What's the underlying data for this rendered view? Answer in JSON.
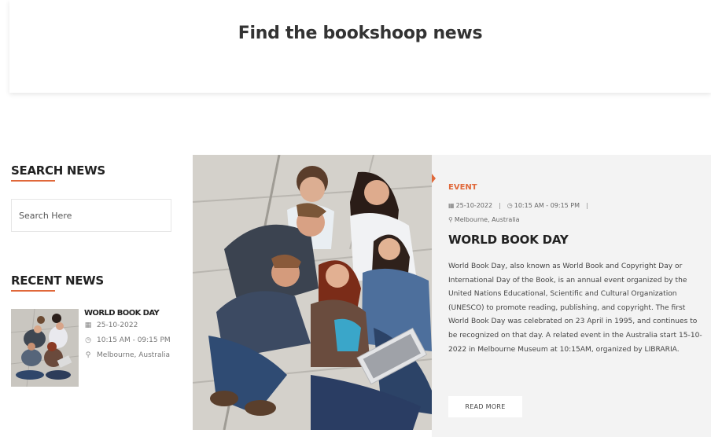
{
  "hero": {
    "title": "Find the bookshoop news"
  },
  "sidebar": {
    "search_title": "SEARCH NEWS",
    "search_placeholder": "Search Here",
    "recent_title": "RECENT NEWS",
    "recent_items": [
      {
        "title": "WORLD BOOK DAY",
        "date": "25-10-2022",
        "time": "10:15 AM - 09:15 PM",
        "location": "Melbourne, Australia"
      }
    ]
  },
  "article": {
    "category": "EVENT",
    "date": "25-10-2022",
    "time": "10:15 AM - 09:15 PM",
    "location": "Melbourne, Australia",
    "title": "WORLD BOOK DAY",
    "description": "World Book Day, also known as World Book and Copyright Day or International Day of the Book, is an annual event organized by the United Nations Educational, Scientific and Cultural Organization (UNESCO) to promote reading, publishing, and copyright. The first World Book Day was celebrated on 23 April in 1995, and continues to be recognized on that day. A related event in the Australia start 15-10-2022 in Melbourne Museum at 10:15AM, organized by LIBRARIA.",
    "read_more": "READ MORE"
  },
  "colors": {
    "accent": "#e0683a",
    "panel_bg": "#f3f3f3"
  },
  "icons": {
    "date": "calendar-icon",
    "time": "clock-icon",
    "location": "map-pin-icon"
  }
}
